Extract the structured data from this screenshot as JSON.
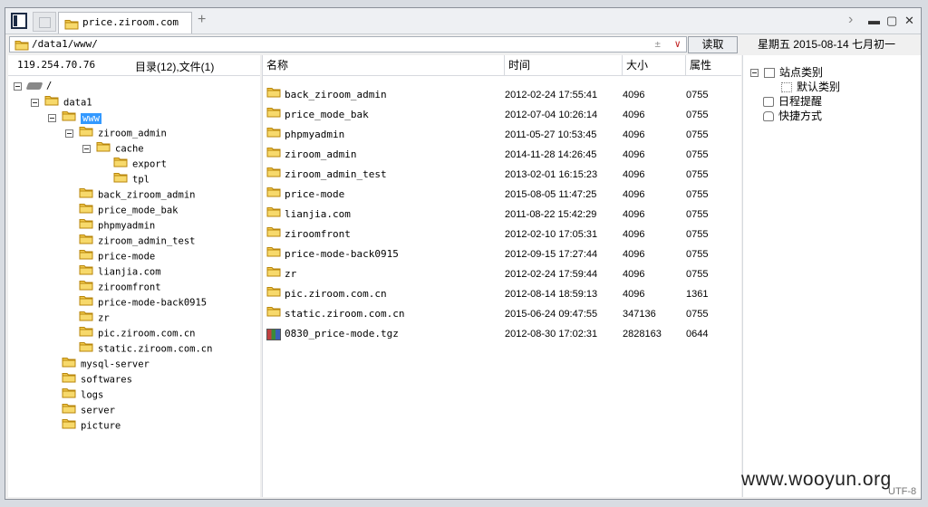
{
  "tab": {
    "title": "price.ziroom.com"
  },
  "address": {
    "path": "/data1/www/",
    "read_label": "读取"
  },
  "date_line": "星期五 2015-08-14 七月初一",
  "left": {
    "ip": "119.254.70.76",
    "count": "目录(12),文件(1)",
    "tree": [
      {
        "label": "/",
        "level": 0,
        "type": "drive",
        "expanded": true
      },
      {
        "label": "data1",
        "level": 1,
        "type": "folder",
        "expanded": true
      },
      {
        "label": "www",
        "level": 2,
        "type": "folder",
        "expanded": true,
        "selected": true
      },
      {
        "label": "ziroom_admin",
        "level": 3,
        "type": "folder",
        "expanded": true
      },
      {
        "label": "cache",
        "level": 4,
        "type": "folder",
        "expanded": true
      },
      {
        "label": "export",
        "level": 5,
        "type": "folder"
      },
      {
        "label": "tpl",
        "level": 5,
        "type": "folder"
      },
      {
        "label": "back_ziroom_admin",
        "level": 3,
        "type": "folder"
      },
      {
        "label": "price_mode_bak",
        "level": 3,
        "type": "folder"
      },
      {
        "label": "phpmyadmin",
        "level": 3,
        "type": "folder"
      },
      {
        "label": "ziroom_admin_test",
        "level": 3,
        "type": "folder"
      },
      {
        "label": "price-mode",
        "level": 3,
        "type": "folder"
      },
      {
        "label": "lianjia.com",
        "level": 3,
        "type": "folder"
      },
      {
        "label": "ziroomfront",
        "level": 3,
        "type": "folder"
      },
      {
        "label": "price-mode-back0915",
        "level": 3,
        "type": "folder"
      },
      {
        "label": "zr",
        "level": 3,
        "type": "folder"
      },
      {
        "label": "pic.ziroom.com.cn",
        "level": 3,
        "type": "folder"
      },
      {
        "label": "static.ziroom.com.cn",
        "level": 3,
        "type": "folder"
      },
      {
        "label": "mysql-server",
        "level": 2,
        "type": "folder"
      },
      {
        "label": "softwares",
        "level": 2,
        "type": "folder"
      },
      {
        "label": "logs",
        "level": 2,
        "type": "folder"
      },
      {
        "label": "server",
        "level": 2,
        "type": "folder"
      },
      {
        "label": "picture",
        "level": 2,
        "type": "folder"
      }
    ]
  },
  "table": {
    "headers": {
      "name": "名称",
      "time": "时间",
      "size": "大小",
      "attr": "属性"
    },
    "rows": [
      {
        "name": "back_ziroom_admin",
        "time": "2012-02-24 17:55:41",
        "size": "4096",
        "attr": "0755",
        "type": "folder"
      },
      {
        "name": "price_mode_bak",
        "time": "2012-07-04 10:26:14",
        "size": "4096",
        "attr": "0755",
        "type": "folder"
      },
      {
        "name": "phpmyadmin",
        "time": "2011-05-27 10:53:45",
        "size": "4096",
        "attr": "0755",
        "type": "folder"
      },
      {
        "name": "ziroom_admin",
        "time": "2014-11-28 14:26:45",
        "size": "4096",
        "attr": "0755",
        "type": "folder"
      },
      {
        "name": "ziroom_admin_test",
        "time": "2013-02-01 16:15:23",
        "size": "4096",
        "attr": "0755",
        "type": "folder"
      },
      {
        "name": "price-mode",
        "time": "2015-08-05 11:47:25",
        "size": "4096",
        "attr": "0755",
        "type": "folder"
      },
      {
        "name": "lianjia.com",
        "time": "2011-08-22 15:42:29",
        "size": "4096",
        "attr": "0755",
        "type": "folder"
      },
      {
        "name": "ziroomfront",
        "time": "2012-02-10 17:05:31",
        "size": "4096",
        "attr": "0755",
        "type": "folder"
      },
      {
        "name": "price-mode-back0915",
        "time": "2012-09-15 17:27:44",
        "size": "4096",
        "attr": "0755",
        "type": "folder"
      },
      {
        "name": "zr",
        "time": "2012-02-24 17:59:44",
        "size": "4096",
        "attr": "0755",
        "type": "folder"
      },
      {
        "name": "pic.ziroom.com.cn",
        "time": "2012-08-14 18:59:13",
        "size": "4096",
        "attr": "1361",
        "type": "folder"
      },
      {
        "name": "static.ziroom.com.cn",
        "time": "2015-06-24 09:47:55",
        "size": "347136",
        "attr": "0755",
        "type": "folder"
      },
      {
        "name": "0830_price-mode.tgz",
        "time": "2012-08-30 17:02:31",
        "size": "2828163",
        "attr": "0644",
        "type": "archive"
      }
    ]
  },
  "side": {
    "items": [
      {
        "label": "站点类别",
        "kind": "group"
      },
      {
        "label": "默认类别",
        "kind": "child"
      },
      {
        "label": "日程提醒",
        "kind": "item"
      },
      {
        "label": "快捷方式",
        "kind": "item"
      }
    ]
  },
  "watermark": "www.wooyun.org",
  "encoding": "UTF-8",
  "colors": {
    "folder": "#f2c94c",
    "folder_edge": "#b8860b",
    "selection": "#3399ff"
  }
}
